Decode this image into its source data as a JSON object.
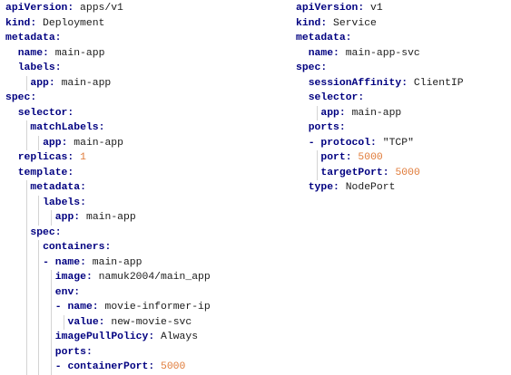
{
  "left_pane": {
    "lines": [
      {
        "indent": 0,
        "key": "apiVersion:",
        "value": "apps/v1",
        "value_type": "text"
      },
      {
        "indent": 0,
        "key": "kind:",
        "value": "Deployment",
        "value_type": "text"
      },
      {
        "indent": 0,
        "key": "metadata:",
        "value": "",
        "value_type": "text"
      },
      {
        "indent": 1,
        "key": "name:",
        "value": "main-app",
        "value_type": "text"
      },
      {
        "indent": 1,
        "key": "labels:",
        "value": "",
        "value_type": "text"
      },
      {
        "indent": 2,
        "key": "app:",
        "value": "main-app",
        "value_type": "text"
      },
      {
        "indent": 0,
        "key": "spec:",
        "value": "",
        "value_type": "text"
      },
      {
        "indent": 1,
        "key": "selector:",
        "value": "",
        "value_type": "text"
      },
      {
        "indent": 2,
        "key": "matchLabels:",
        "value": "",
        "value_type": "text"
      },
      {
        "indent": 3,
        "key": "app:",
        "value": "main-app",
        "value_type": "text"
      },
      {
        "indent": 1,
        "key": "replicas:",
        "value": "1",
        "value_type": "number"
      },
      {
        "indent": 1,
        "key": "template:",
        "value": "",
        "value_type": "text"
      },
      {
        "indent": 2,
        "key": "metadata:",
        "value": "",
        "value_type": "text"
      },
      {
        "indent": 3,
        "key": "labels:",
        "value": "",
        "value_type": "text"
      },
      {
        "indent": 4,
        "key": "app:",
        "value": "main-app",
        "value_type": "text"
      },
      {
        "indent": 2,
        "key": "spec:",
        "value": "",
        "value_type": "text"
      },
      {
        "indent": 3,
        "key": "containers:",
        "value": "",
        "value_type": "text"
      },
      {
        "indent": 3,
        "dash": true,
        "key": "name:",
        "value": "main-app",
        "value_type": "text"
      },
      {
        "indent": 4,
        "key": "image:",
        "value": "namuk2004/main_app",
        "value_type": "text"
      },
      {
        "indent": 4,
        "key": "env:",
        "value": "",
        "value_type": "text"
      },
      {
        "indent": 4,
        "dash": true,
        "key": "name:",
        "value": "movie-informer-ip",
        "value_type": "text"
      },
      {
        "indent": 5,
        "key": "value:",
        "value": "new-movie-svc",
        "value_type": "text"
      },
      {
        "indent": 4,
        "key": "imagePullPolicy:",
        "value": "Always",
        "value_type": "text"
      },
      {
        "indent": 4,
        "key": "ports:",
        "value": "",
        "value_type": "text"
      },
      {
        "indent": 4,
        "dash": true,
        "key": "containerPort:",
        "value": "5000",
        "value_type": "number"
      }
    ]
  },
  "right_pane": {
    "lines": [
      {
        "indent": 0,
        "key": "apiVersion:",
        "value": "v1",
        "value_type": "text"
      },
      {
        "indent": 0,
        "key": "kind:",
        "value": "Service",
        "value_type": "text"
      },
      {
        "indent": 0,
        "key": "metadata:",
        "value": "",
        "value_type": "text"
      },
      {
        "indent": 1,
        "key": "name:",
        "value": "main-app-svc",
        "value_type": "text"
      },
      {
        "indent": 0,
        "key": "spec:",
        "value": "",
        "value_type": "text"
      },
      {
        "indent": 1,
        "key": "sessionAffinity:",
        "value": "ClientIP",
        "value_type": "text"
      },
      {
        "indent": 1,
        "key": "selector:",
        "value": "",
        "value_type": "text"
      },
      {
        "indent": 2,
        "key": "app:",
        "value": "main-app",
        "value_type": "text"
      },
      {
        "indent": 1,
        "key": "ports:",
        "value": "",
        "value_type": "text"
      },
      {
        "indent": 1,
        "dash": true,
        "key": "protocol:",
        "value": "\"TCP\"",
        "value_type": "text"
      },
      {
        "indent": 2,
        "key": "port:",
        "value": "5000",
        "value_type": "number"
      },
      {
        "indent": 2,
        "key": "targetPort:",
        "value": "5000",
        "value_type": "number"
      },
      {
        "indent": 1,
        "key": "type:",
        "value": "NodePort",
        "value_type": "text"
      }
    ]
  },
  "colors": {
    "key": "#000080",
    "number": "#e07b39",
    "text": "#1a1a1a",
    "background": "#ffffff",
    "indent_guide": "#d4d4d4"
  }
}
